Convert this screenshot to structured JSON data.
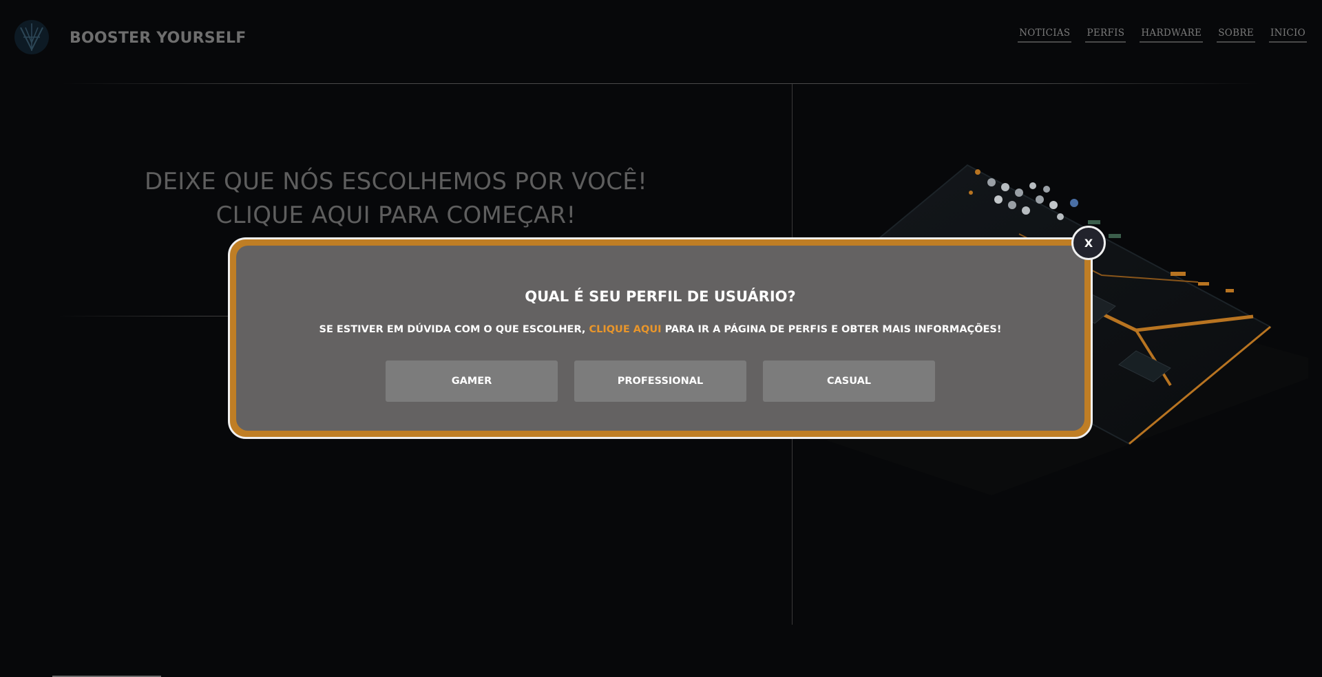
{
  "header": {
    "brand": "BOOSTER YOURSELF",
    "nav": [
      {
        "label": "NOTICIAS"
      },
      {
        "label": "PERFIS"
      },
      {
        "label": "HARDWARE"
      },
      {
        "label": "SOBRE"
      },
      {
        "label": "INICIO"
      }
    ]
  },
  "hero": {
    "line1": "DEIXE QUE NÓS ESCOLHEMOS POR VOCÊ!",
    "line2": "CLIQUE AQUI PARA COMEÇAR!"
  },
  "modal": {
    "title": "QUAL É SEU PERFIL DE USUÁRIO?",
    "subtitle_before": "SE ESTIVER EM DÚVIDA COM O QUE ESCOLHER, ",
    "subtitle_link": "CLIQUE AQUI",
    "subtitle_after": " PARA IR A PÁGINA DE PERFIS E OBTER MAIS INFORMAÇÕES!",
    "options": [
      {
        "label": "GAMER"
      },
      {
        "label": "PROFESSIONAL"
      },
      {
        "label": "CASUAL"
      }
    ],
    "close_label": "X"
  },
  "colors": {
    "background": "#07080a",
    "modal_border": "#bf7e25",
    "modal_fill": "#646262",
    "accent_link": "#e9962b",
    "button_fill": "#7c7c7c"
  },
  "icons": {
    "logo": "brand-logo-icon",
    "close": "close-icon"
  }
}
